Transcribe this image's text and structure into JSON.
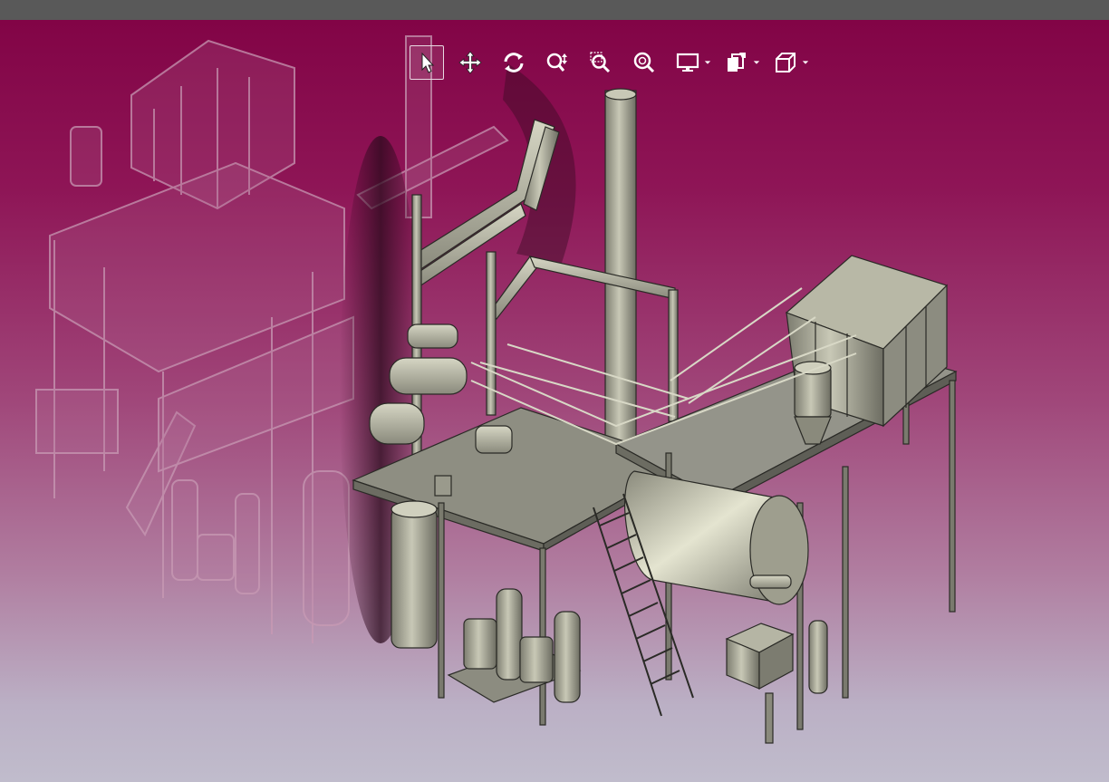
{
  "window": {
    "title": ""
  },
  "toolbar": {
    "tools": [
      {
        "id": "select",
        "icon": "cursor-arrow-icon",
        "active": true
      },
      {
        "id": "pan",
        "icon": "move-arrows-icon",
        "active": false
      },
      {
        "id": "rotate",
        "icon": "rotate-icon",
        "active": false
      },
      {
        "id": "zoom",
        "icon": "zoom-updown-icon",
        "active": false
      },
      {
        "id": "zoom-window",
        "icon": "zoom-window-icon",
        "active": false
      },
      {
        "id": "zoom-fit",
        "icon": "zoom-fit-icon",
        "active": false
      },
      {
        "id": "display",
        "icon": "monitor-icon",
        "dropdown": true
      },
      {
        "id": "section",
        "icon": "section-plane-icon",
        "dropdown": true
      },
      {
        "id": "view-cube",
        "icon": "view-cube-icon",
        "dropdown": true
      }
    ]
  },
  "colors": {
    "titlebar": "#595959",
    "background_top": "#820446",
    "background_bottom": "#c0bccc",
    "model_metal": "#a8a89a",
    "model_edge": "#2a2a26",
    "ghost": "#c99ab6"
  }
}
